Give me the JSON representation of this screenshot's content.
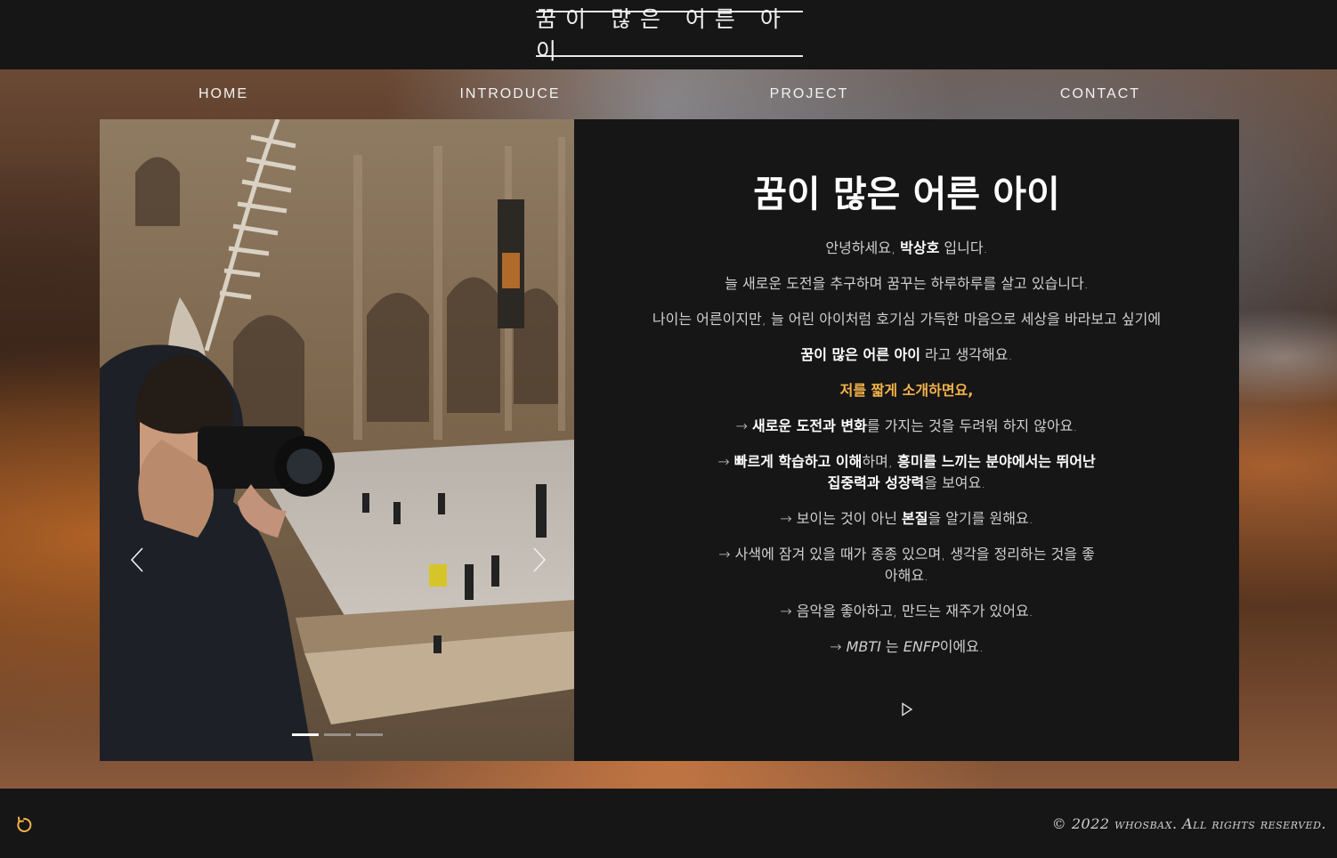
{
  "header": {
    "logo": "꿈이 많은 어른 아이"
  },
  "nav": [
    {
      "label": "HOME"
    },
    {
      "label": "INTRODUCE"
    },
    {
      "label": "PROJECT"
    },
    {
      "label": "CONTACT"
    }
  ],
  "slider": {
    "prev_icon": "chevron-left-icon",
    "next_icon": "chevron-right-icon",
    "dots": 3,
    "active_dot": 0
  },
  "intro": {
    "title": "꿈이 많은 어른 아이",
    "p1_pre": "안녕하세요, ",
    "p1_name": "박상호",
    "p1_post": " 입니다.",
    "p2": "늘 새로운 도전을 추구하며 꿈꾸는 하루하루를 살고 있습니다.",
    "p3": "나이는 어른이지만, 늘 어린 아이처럼 호기심 가득한 마음으로 세상을 바라보고 싶기에",
    "p4_bold": "꿈이 많은 어른 아이",
    "p4_post": " 라고 생각해요.",
    "p5": "저를 짧게 소개하면요,",
    "p6_pre": "→ ",
    "p6_bold": "새로운 도전과 변화",
    "p6_post": "를 가지는 것을 두려워 하지 않아요.",
    "p7_pre": "→ ",
    "p7_bold1": "빠르게 학습하고 이해",
    "p7_mid": "하며, ",
    "p7_bold2": "흥미를 느끼는 분야에서는 뛰어난",
    "p7_bold3": "집중력과 성장력",
    "p7_post": "을 보여요.",
    "p8_pre": "→ 보이는 것이 아닌 ",
    "p8_bold": "본질",
    "p8_post": "을 알기를 원해요.",
    "p9_line1": "→ 사색에 잠겨 있을 때가 종종 있으며, 생각을 정리하는 것을 좋",
    "p9_line2": "아해요.",
    "p10": "→ 음악을 좋아하고, 만드는 재주가 있어요.",
    "p11_pre": "→ ",
    "p11_mbti": "MBTI",
    "p11_mid": " 는 ",
    "p11_type": "ENFP",
    "p11_post": "이에요.",
    "play_icon": "play-icon"
  },
  "footer": {
    "refresh_icon": "refresh-icon",
    "copyright": "© 2022 whosbax. All rights reserved."
  },
  "colors": {
    "accent": "#f3b34a",
    "background": "#161616",
    "refresh": "#f3b34a"
  }
}
